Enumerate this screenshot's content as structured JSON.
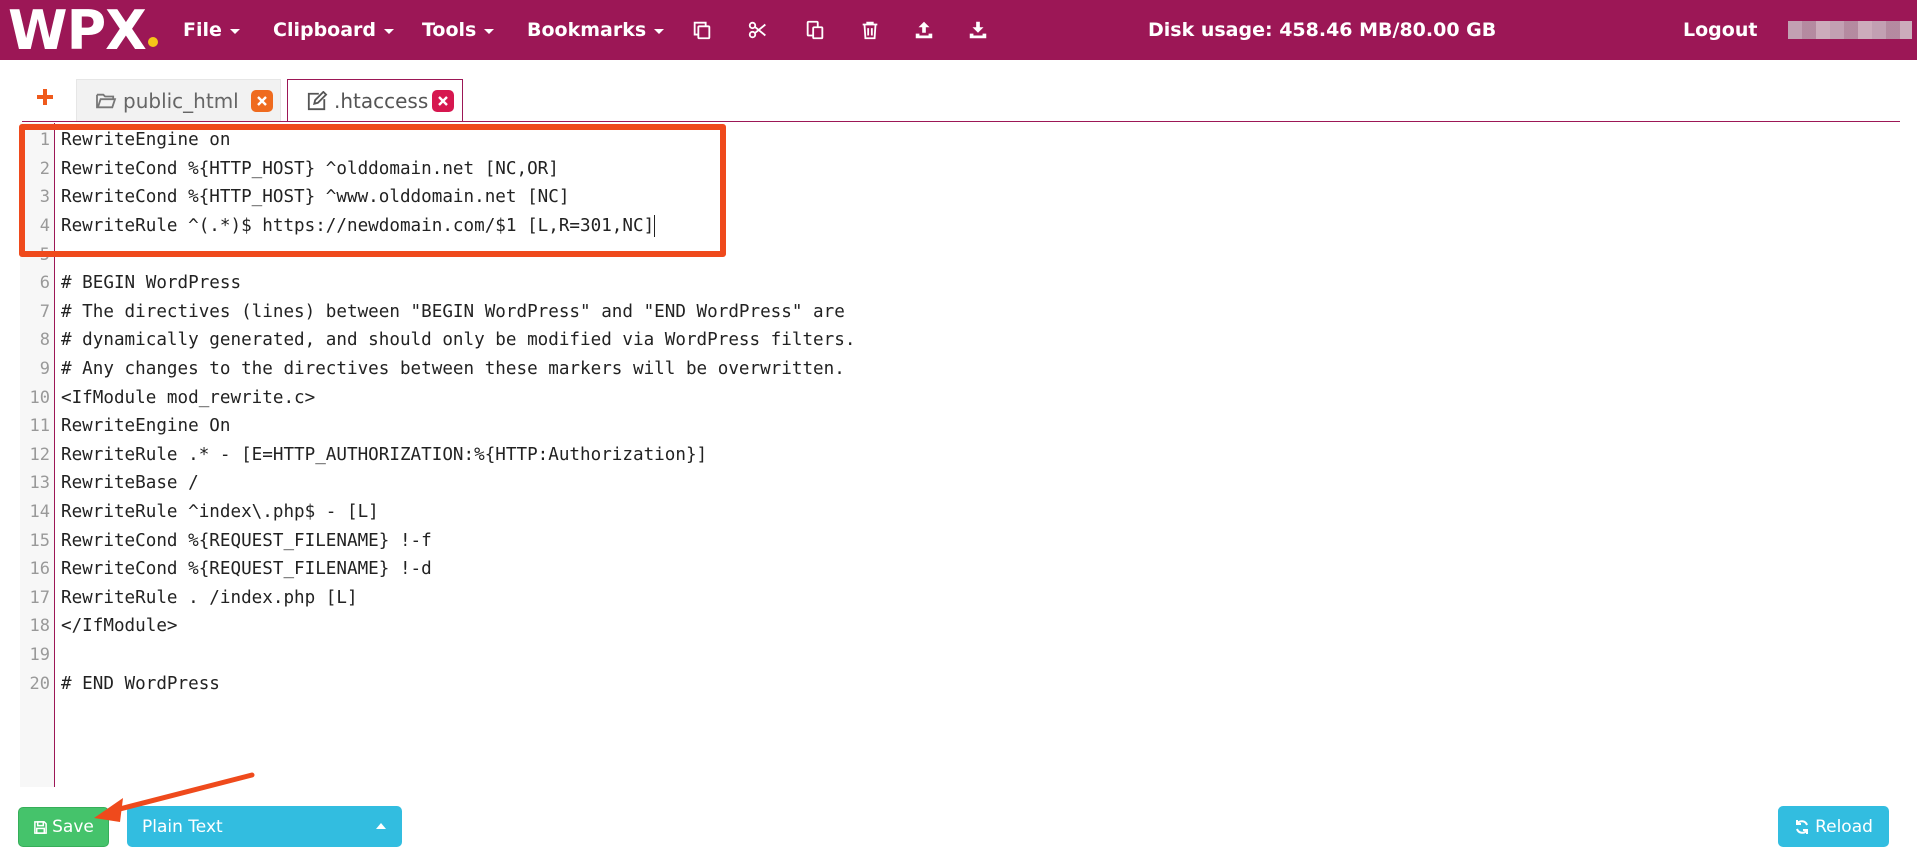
{
  "brand": {
    "logo_text": "WPX",
    "dot_color": "#f5c518",
    "bar_color": "#9c1756"
  },
  "menu": [
    {
      "label": "File"
    },
    {
      "label": "Clipboard"
    },
    {
      "label": "Tools"
    },
    {
      "label": "Bookmarks"
    }
  ],
  "toolbar_icons": [
    "copy-icon",
    "cut-icon",
    "paste-icon",
    "trash-icon",
    "upload-icon",
    "download-icon"
  ],
  "header": {
    "disk_usage": "Disk usage: 458.46 MB/80.00 GB",
    "logout": "Logout"
  },
  "tabs": [
    {
      "label": "public_html",
      "icon": "folder-open-icon",
      "active": false
    },
    {
      "label": ".htaccess",
      "icon": "edit-icon",
      "active": true
    }
  ],
  "editor": {
    "lines": [
      "RewriteEngine on",
      "RewriteCond %{HTTP_HOST} ^olddomain.net [NC,OR]",
      "RewriteCond %{HTTP_HOST} ^www.olddomain.net [NC]",
      "RewriteRule ^(.*)$ https://newdomain.com/$1 [L,R=301,NC]",
      "",
      "# BEGIN WordPress",
      "# The directives (lines) between \"BEGIN WordPress\" and \"END WordPress\" are",
      "# dynamically generated, and should only be modified via WordPress filters.",
      "# Any changes to the directives between these markers will be overwritten.",
      "<IfModule mod_rewrite.c>",
      "RewriteEngine On",
      "RewriteRule .* - [E=HTTP_AUTHORIZATION:%{HTTP:Authorization}]",
      "RewriteBase /",
      "RewriteRule ^index\\.php$ - [L]",
      "RewriteCond %{REQUEST_FILENAME} !-f",
      "RewriteCond %{REQUEST_FILENAME} !-d",
      "RewriteRule . /index.php [L]",
      "</IfModule>",
      "",
      "# END WordPress"
    ],
    "cursor_line": 4
  },
  "footer": {
    "save_label": "Save",
    "mode_label": "Plain Text",
    "reload_label": "Reload"
  },
  "annotation_color": "#ef4a1c"
}
